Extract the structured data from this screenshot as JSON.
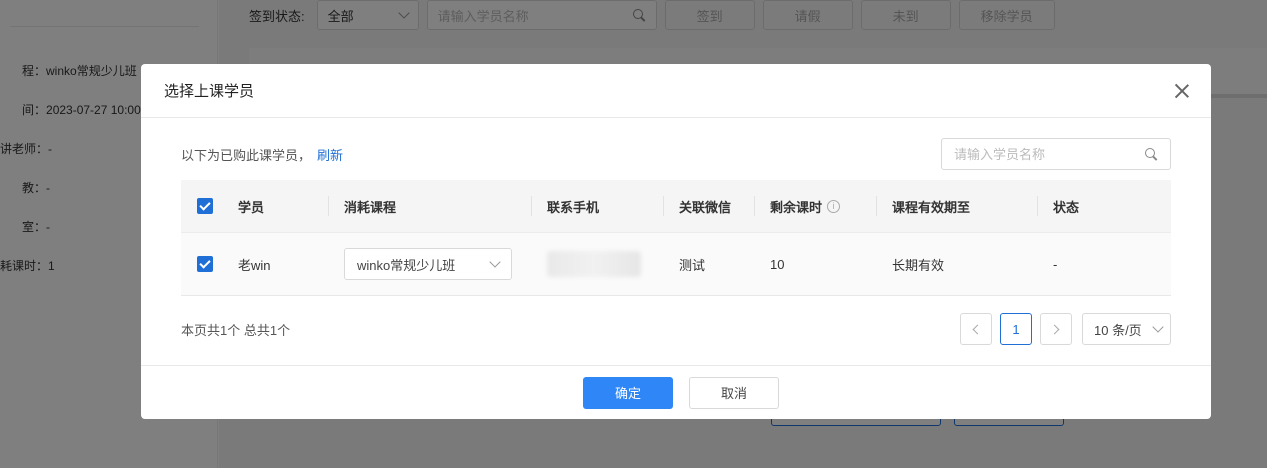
{
  "background": {
    "info": [
      {
        "label": "程：",
        "value": "winko常规少儿班"
      },
      {
        "label": "间：",
        "value": "2023-07-27 10:00"
      },
      {
        "label": "讲老师：",
        "value": "-"
      },
      {
        "label": "教：",
        "value": "-"
      },
      {
        "label": "室：",
        "value": "-"
      },
      {
        "label": "耗课时：",
        "value": "1"
      }
    ],
    "filter": {
      "label": "签到状态:",
      "status_value": "全部",
      "search_placeholder": "请输入学员名称",
      "buttons": [
        "签到",
        "请假",
        "未到",
        "移除学员"
      ]
    }
  },
  "modal": {
    "title": "选择上课学员",
    "notice": "以下为已购此课学员，",
    "refresh": "刷新",
    "search_placeholder": "请输入学员名称",
    "columns": [
      "学员",
      "消耗课程",
      "联系手机",
      "关联微信",
      "剩余课时",
      "课程有效期至",
      "状态"
    ],
    "rows": [
      {
        "name": "老win",
        "course": "winko常规少儿班",
        "phone": "",
        "wechat": "测试",
        "remaining": "10",
        "expiry": "长期有效",
        "status": "-"
      }
    ],
    "summary": "本页共1个 总共1个",
    "pagination": {
      "current_page": "1",
      "page_size": "10 条/页"
    },
    "confirm": "确定",
    "cancel": "取消"
  },
  "colors": {
    "accent": "#2f86f6",
    "link": "#1f6fd6",
    "mask": "rgba(0,0,0,0.5)"
  }
}
